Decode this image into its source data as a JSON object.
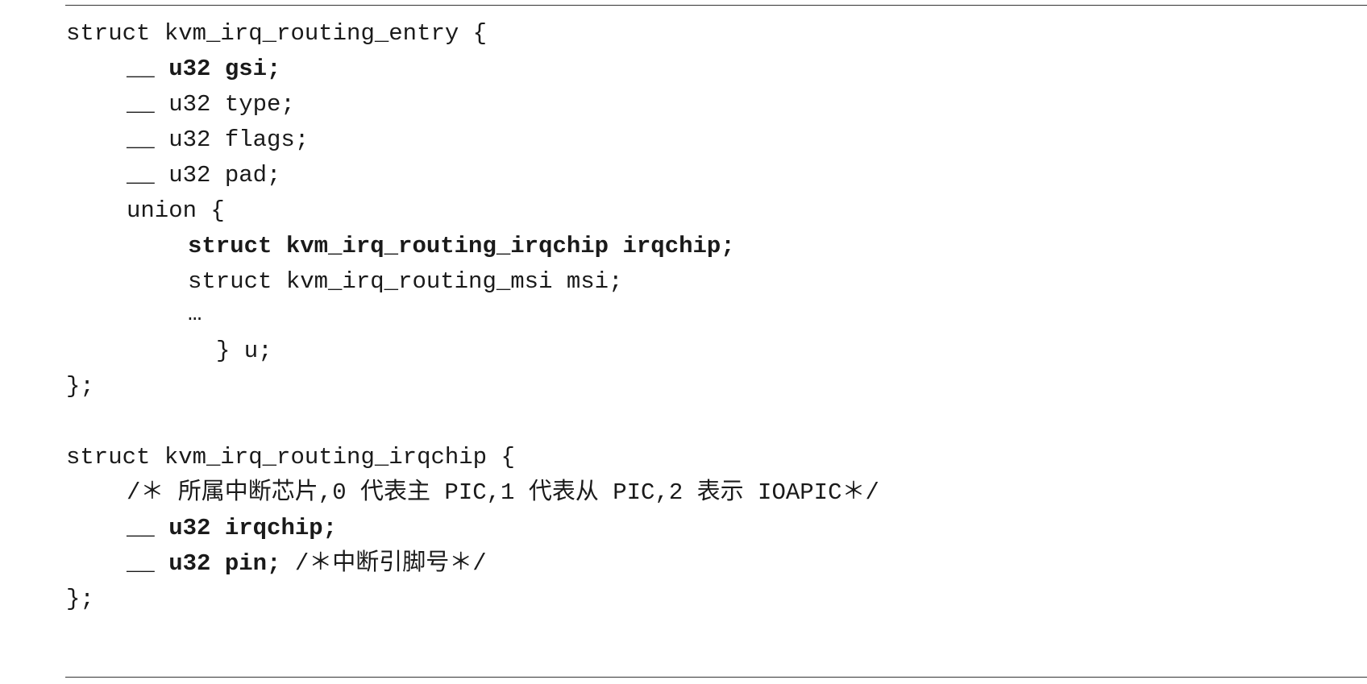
{
  "lines": [
    {
      "text": "struct kvm_irq_routing_entry {"
    },
    {
      "pre": "__ ",
      "bold": "u32 gsi;"
    },
    {
      "text": "__ u32 type;"
    },
    {
      "text": "__ u32 flags;"
    },
    {
      "text": "__ u32 pad;"
    },
    {
      "text": "union {"
    },
    {
      "bold": "struct kvm_irq_routing_irqchip irqchip;"
    },
    {
      "text": "struct kvm_irq_routing_msi msi;"
    },
    {
      "text": "…"
    },
    {
      "text": "} u;"
    },
    {
      "text": "};"
    },
    {
      "text": "struct kvm_irq_routing_irqchip {"
    },
    {
      "text": "/＊ 所属中断芯片,0 代表主 PIC,1 代表从 PIC,2 表示 IOAPIC＊/"
    },
    {
      "pre": "__ ",
      "bold": "u32 irqchip;"
    },
    {
      "pre": "__ ",
      "bold": "u32 pin;",
      "post": " /＊中断引脚号＊/"
    },
    {
      "text": "};"
    }
  ]
}
